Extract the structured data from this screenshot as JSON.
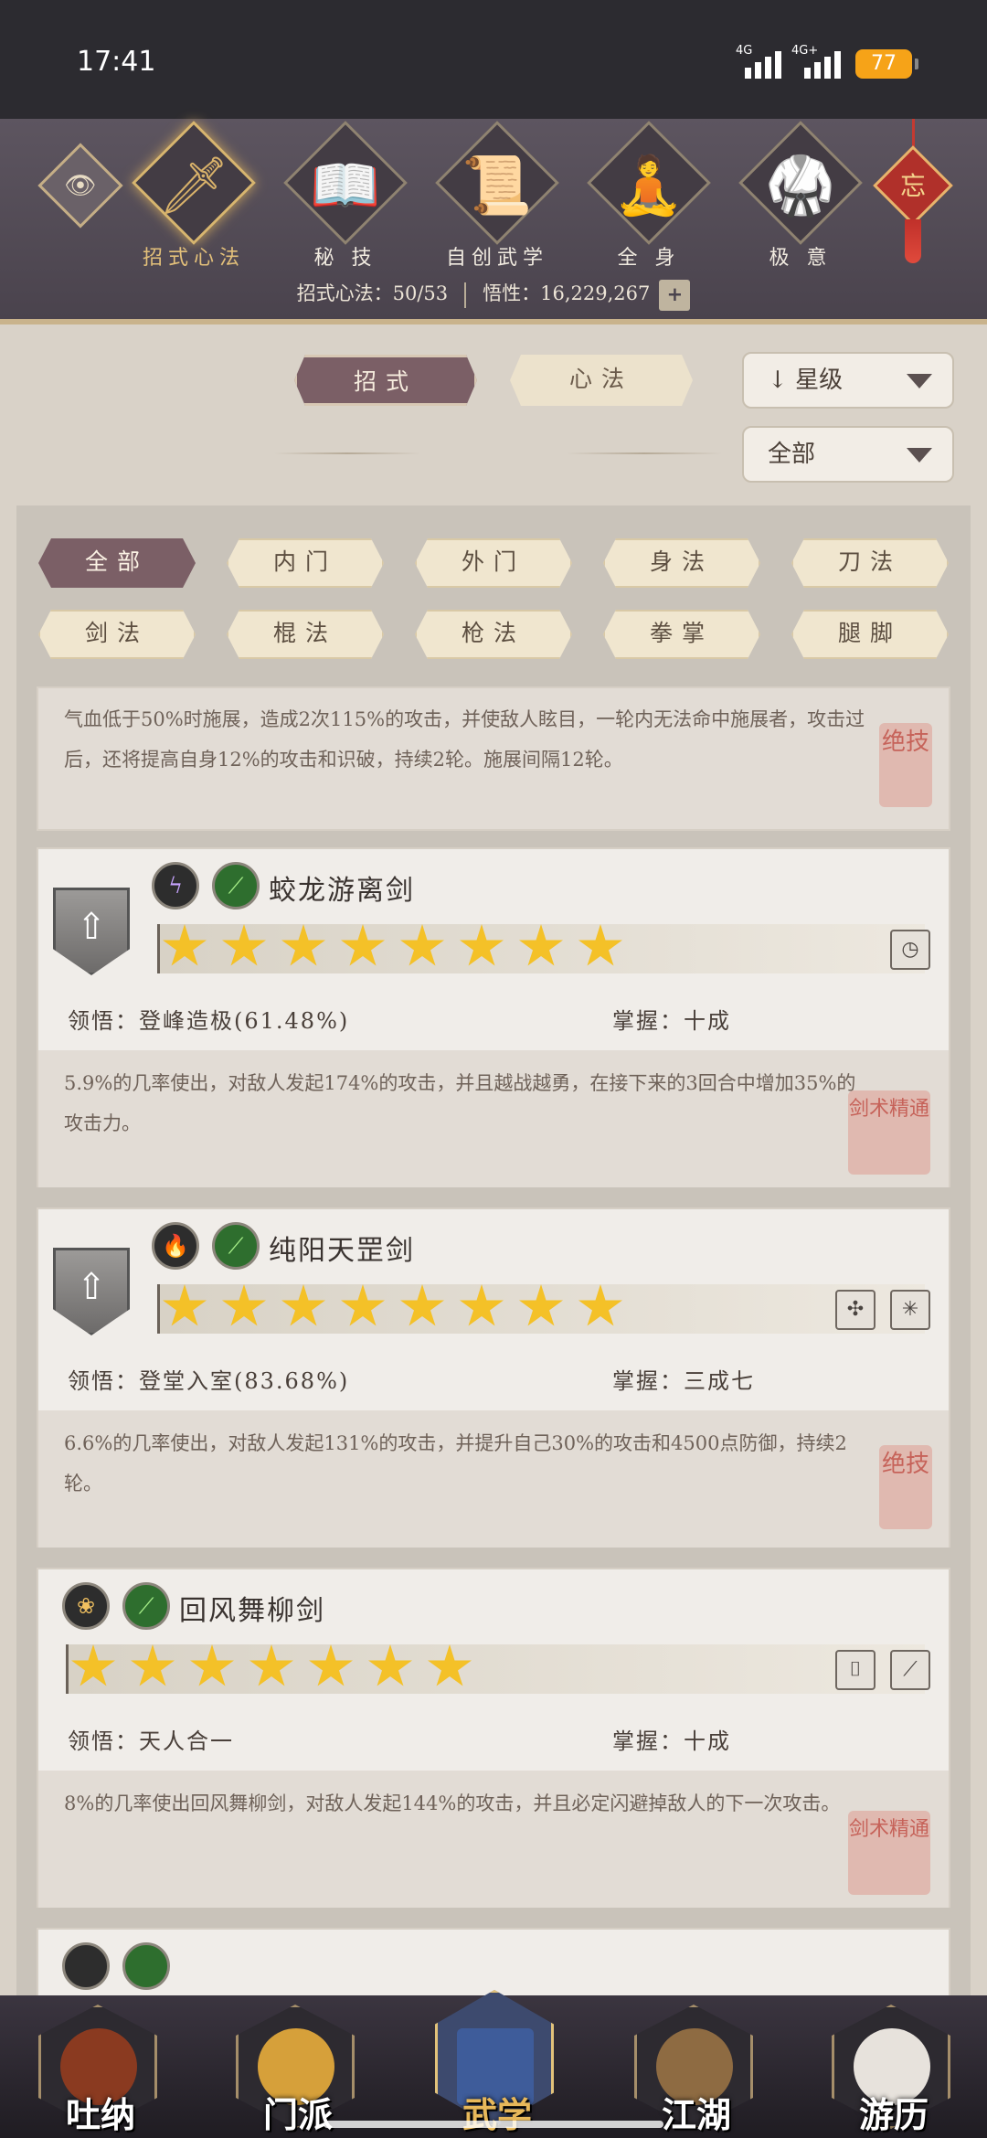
{
  "status": {
    "time": "17:41",
    "net1": "4G",
    "net2": "4G+",
    "battery": "77"
  },
  "header": {
    "tabs": [
      {
        "label": "招式心法",
        "glyph": "🗡",
        "active": true
      },
      {
        "label": "秘 技",
        "glyph": "📖"
      },
      {
        "label": "自创武学",
        "glyph": "📜"
      },
      {
        "label": "全 身",
        "glyph": "🧘"
      },
      {
        "label": "极 意",
        "glyph": "🥋"
      }
    ],
    "knot_char": "忘",
    "progress_label": "招式心法：50/53",
    "wuxing_label": "悟性：16,229,267",
    "plus": "+"
  },
  "toggles": {
    "zhaoshi": "招式",
    "xinfa": "心法",
    "sort_label": "星级",
    "sort_arrow": "↓",
    "filter_all": "全部"
  },
  "filters": [
    {
      "label": "全部",
      "active": true
    },
    {
      "label": "内门"
    },
    {
      "label": "外门"
    },
    {
      "label": "身法"
    },
    {
      "label": "刀法"
    },
    {
      "label": "剑法"
    },
    {
      "label": "棍法"
    },
    {
      "label": "枪法"
    },
    {
      "label": "拳掌"
    },
    {
      "label": "腿脚"
    }
  ],
  "top_desc": {
    "text": "气血低于50%时施展，造成2次115%的攻击，并使敌人眩目，一轮内无法命中施展者，攻击过后，还将提高自身12%的攻击和识破，持续2轮。施展间隔12轮。",
    "seal": "绝技"
  },
  "skills": [
    {
      "name": "蛟龙游离剑",
      "elem1": "ϟ",
      "elem2": "⟋",
      "stars": 8,
      "lingwu": "领悟：登峰造极(61.48%)",
      "zhangwo": "掌握：十成",
      "desc": "5.9%的几率使出，对敌人发起174%的攻击，并且越战越勇，在接下来的3回合中增加35%的攻击力。",
      "seal": "剑术精通",
      "icons": [
        "◷"
      ]
    },
    {
      "name": "纯阳天罡剑",
      "elem1": "🔥",
      "elem2": "⟋",
      "stars": 8,
      "lingwu": "领悟：登堂入室(83.68%)",
      "zhangwo": "掌握：三成七",
      "desc": "6.6%的几率使出，对敌人发起131%的攻击，并提升自己30%的攻击和4500点防御，持续2轮。",
      "seal": "绝技",
      "icons": [
        "✣",
        "✳"
      ]
    },
    {
      "name": "回风舞柳剑",
      "elem1": "❀",
      "elem2": "⟋",
      "stars": 7,
      "lingwu": "领悟：天人合一",
      "zhangwo": "掌握：十成",
      "desc": "8%的几率使出回风舞柳剑，对敌人发起144%的攻击，并且必定闪避掉敌人的下一次攻击。",
      "seal": "剑术精通",
      "icons": [
        "⌷",
        "⟋"
      ]
    }
  ],
  "bottom_nav": [
    {
      "label": "吐纳",
      "color": "#8a3a20"
    },
    {
      "label": "门派",
      "color": "#d6a03a"
    },
    {
      "label": "武学",
      "color": "#3e5c9a",
      "active": true
    },
    {
      "label": "江湖",
      "color": "#8e6b42"
    },
    {
      "label": "游历",
      "color": "#e7e2dc"
    }
  ]
}
